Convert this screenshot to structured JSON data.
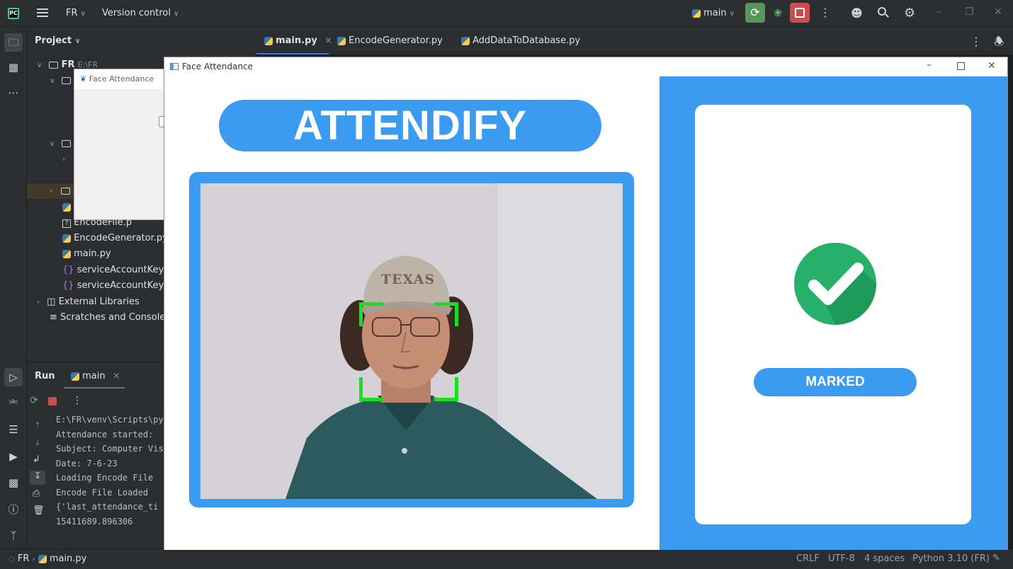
{
  "ide": {
    "project_name": "FR",
    "vcs_label": "Version control",
    "run_config": "main",
    "project_panel_title": "Project",
    "tree": {
      "root_label": "FR",
      "root_path": "E:\\FR",
      "items": [
        {
          "label": "EncodeFile.p",
          "kind": "unknown"
        },
        {
          "label": "EncodeGenerator.py",
          "kind": "python"
        },
        {
          "label": "main.py",
          "kind": "python"
        },
        {
          "label": "serviceAccountKey.jso",
          "kind": "json"
        },
        {
          "label": "serviceAccountKey1.js",
          "kind": "json"
        }
      ],
      "external_libraries": "External Libraries",
      "scratches": "Scratches and Consoles"
    },
    "tabs": [
      {
        "label": "main.py",
        "active": true
      },
      {
        "label": "EncodeGenerator.py",
        "active": false
      },
      {
        "label": "AddDataToDatabase.py",
        "active": false
      }
    ],
    "run_panel": {
      "title": "Run",
      "tab_label": "main",
      "console_lines": [
        "E:\\FR\\venv\\Scripts\\py",
        "Attendance started:",
        "Subject: Computer Vis",
        "Date: 7-6-23",
        "Loading Encode File",
        "Encode File Loaded",
        "{'last_attendance_ti",
        "15411689.896306"
      ]
    },
    "status_bar": {
      "breadcrumb_project": "FR",
      "breadcrumb_file": "main.py",
      "line_separator": "CRLF",
      "encoding": "UTF-8",
      "indent": "4 spaces",
      "interpreter": "Python 3.10 (FR)"
    }
  },
  "small_window": {
    "title": "Face Attendance"
  },
  "app_window": {
    "title": "Face Attendance",
    "banner_text": "ATTENDIFY",
    "status_text": "MARKED",
    "colors": {
      "accent_blue": "#3a9bf0",
      "check_green": "#27b06a",
      "face_box_green": "#18e01c"
    },
    "cap_text": "TEXAS"
  }
}
